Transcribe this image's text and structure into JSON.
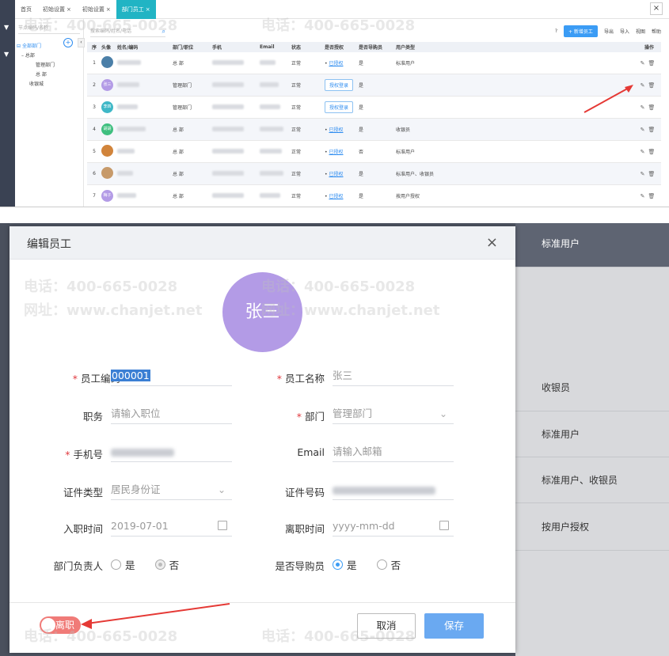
{
  "tabs": [
    {
      "label": "首页",
      "closable": false
    },
    {
      "label": "初始设置",
      "closable": true
    },
    {
      "label": "初始设置",
      "closable": true
    },
    {
      "label": "部门员工",
      "closable": true,
      "active": true
    }
  ],
  "close_glyph": "×",
  "tree": {
    "search_placeholder": "节点编码/名称",
    "nodes": [
      "全部部门",
      "总部",
      "管理部门",
      "总 部",
      "收银城"
    ]
  },
  "toolbar": {
    "search_placeholder": "搜索编码/姓名/电话",
    "help_icon": "?",
    "add_label": "+ 新增员工",
    "export_label": "导出",
    "import_label": "导入",
    "view_label": "视图",
    "help_label": "帮助"
  },
  "table": {
    "headers": [
      "序",
      "头像",
      "姓名/编码",
      "部门/职位",
      "手机",
      "Email",
      "状态",
      "是否授权",
      "是否导购员",
      "用户类型",
      "操作"
    ],
    "rows": [
      {
        "no": "1",
        "avatar": "",
        "dept": "总 部",
        "status": "正常",
        "auth": "已授权",
        "guide": "是",
        "utype": "标准用户"
      },
      {
        "no": "2",
        "avatar": "张三",
        "dept": "管理部门",
        "status": "正常",
        "auth": "授权登录",
        "guide": "是",
        "utype": ""
      },
      {
        "no": "3",
        "avatar": "李四",
        "dept": "管理部门",
        "status": "正常",
        "auth": "授权登录",
        "guide": "是",
        "utype": ""
      },
      {
        "no": "4",
        "avatar": "胡胡",
        "dept": "总 部",
        "status": "正常",
        "auth": "已授权",
        "guide": "是",
        "utype": "收银员"
      },
      {
        "no": "5",
        "avatar": "",
        "dept": "总 部",
        "status": "正常",
        "auth": "已授权",
        "guide": "否",
        "utype": "标准用户"
      },
      {
        "no": "6",
        "avatar": "",
        "dept": "总 部",
        "status": "正常",
        "auth": "已授权",
        "guide": "是",
        "utype": "标准用户、收银员"
      },
      {
        "no": "7",
        "avatar": "梅子",
        "dept": "总 部",
        "status": "正常",
        "auth": "已授权",
        "guide": "是",
        "utype": "按用户授权"
      }
    ]
  },
  "bg_right_rows": [
    "标准用户",
    "收银员",
    "标准用户",
    "标准用户、收银员",
    "按用户授权"
  ],
  "modal": {
    "title": "编辑员工",
    "avatar_text": "张三",
    "emp_code_label": "员工编码",
    "emp_code_value": "000001",
    "emp_name_label": "员工名称",
    "emp_name_value": "张三",
    "position_label": "职务",
    "position_placeholder": "请输入职位",
    "dept_label": "部门",
    "dept_value": "管理部门",
    "phone_label": "手机号",
    "email_label": "Email",
    "email_placeholder": "请输入邮箱",
    "idtype_label": "证件类型",
    "idtype_value": "居民身份证",
    "idno_label": "证件号码",
    "hire_label": "入职时间",
    "hire_value": "2019-07-01",
    "leave_label": "离职时间",
    "leave_placeholder": "yyyy-mm-dd",
    "dept_head_label": "部门负责人",
    "guide_label": "是否导购员",
    "yes": "是",
    "no": "否",
    "toggle_label": "离职",
    "cancel": "取消",
    "save": "保存"
  },
  "watermark": {
    "phone": "电话：400-665-0028",
    "site": "网址：www.chanjet.net"
  },
  "colors": {
    "accent": "#3b9cf5",
    "tab_active": "#21b4c4",
    "avatar": "#b39be6",
    "toggle": "#f07b78",
    "annotation": "#e53935"
  }
}
